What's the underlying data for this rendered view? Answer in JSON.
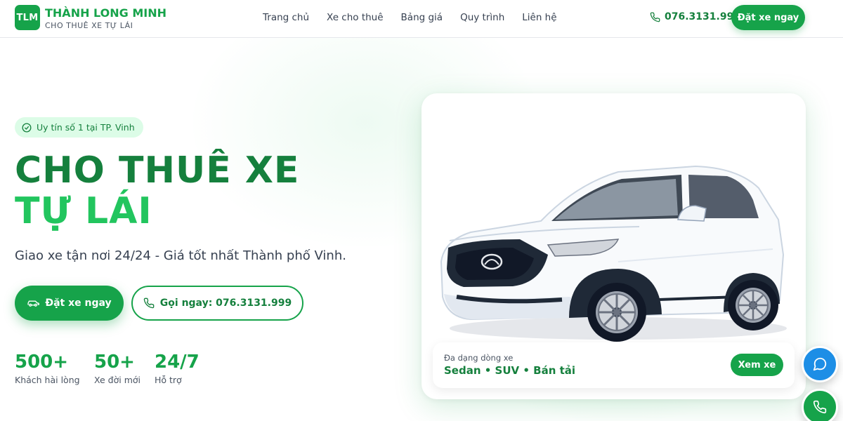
{
  "header": {
    "logo_text": "TLM",
    "brand_name": "THÀNH LONG MINH",
    "brand_tagline": "CHO THUÊ XE TỰ LÁI",
    "nav": [
      "Trang chủ",
      "Xe cho thuê",
      "Bảng giá",
      "Quy trình",
      "Liên hệ"
    ],
    "phone": "076.3131.999",
    "cta_label": "Đặt xe ngay"
  },
  "hero": {
    "badge": "Uy tín số 1 tại TP. Vinh",
    "title_part1": "CHO THUÊ XE ",
    "title_part2": "TỰ LÁI",
    "subtitle": "Giao xe tận nơi 24/24 - Giá tốt nhất Thành phố Vinh.",
    "primary_cta": "Đặt xe ngay",
    "secondary_cta": "Gọi ngay: 076.3131.999",
    "stats": [
      {
        "value": "500+",
        "label": "Khách hài lòng"
      },
      {
        "value": "50+",
        "label": "Xe đời mới"
      },
      {
        "value": "24/7",
        "label": "Hỗ trợ"
      }
    ]
  },
  "car_card": {
    "caption_small": "Đa dạng dòng xe",
    "caption_big": "Sedan • SUV • Bán tải",
    "view_button": "Xem xe"
  },
  "colors": {
    "primary_green": "#16a34a",
    "dark_green": "#15803d",
    "light_green": "#22c55e",
    "chat_blue": "#1d8ee6"
  },
  "icons": {
    "header_phone": "phone-icon",
    "badge": "check-circle-icon",
    "primary_cta": "car-icon",
    "secondary_cta": "phone-icon",
    "fab_chat": "chat-bubble-icon",
    "fab_call": "phone-icon"
  }
}
